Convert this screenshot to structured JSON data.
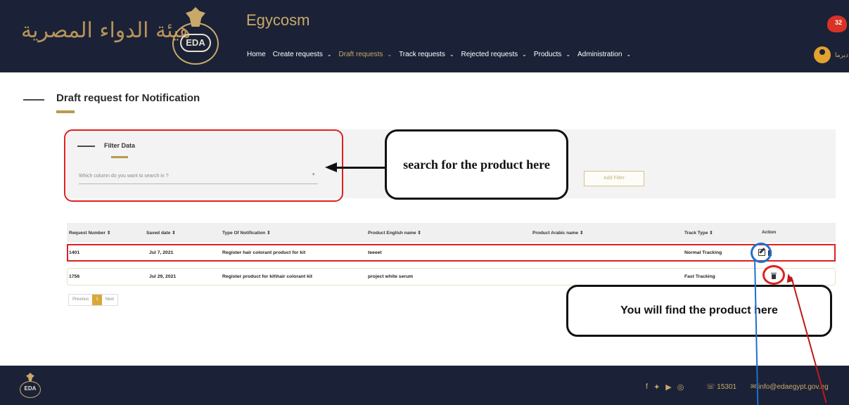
{
  "header": {
    "logo_text": "هيئة الدواء المصرية",
    "emblem_text": "EDA",
    "app_title": "Egycosm",
    "nav": [
      {
        "label": "Home",
        "dropdown": false,
        "active": false
      },
      {
        "label": "Create requests",
        "dropdown": true,
        "active": false
      },
      {
        "label": "Draft requests",
        "dropdown": true,
        "active": true
      },
      {
        "label": "Track requests",
        "dropdown": true,
        "active": false
      },
      {
        "label": "Rejected requests",
        "dropdown": true,
        "active": false
      },
      {
        "label": "Products",
        "dropdown": true,
        "active": false
      },
      {
        "label": "Administration",
        "dropdown": true,
        "active": false
      }
    ],
    "notification_count": "32",
    "user_name": "ديرما"
  },
  "page": {
    "title": "Draft request for Notification"
  },
  "filter": {
    "title": "Filter Data",
    "select_placeholder": "Which column do you want to search in ?",
    "add_filter_label": "Add Filter"
  },
  "table": {
    "columns": [
      "Request Number ⇕",
      "Saved date ⇕",
      "Type Of Notification ⇕",
      "Product English name ⇕",
      "Product Arabic name ⇕",
      "Track Type ⇕",
      "Action"
    ],
    "rows": [
      {
        "request_number": "1401",
        "saved_date": "Jul 7, 2021",
        "type": "Register hair colorant product for kit",
        "english_name": "teeeet",
        "arabic_name": "",
        "track_type": "Normal Tracking"
      },
      {
        "request_number": "1756",
        "saved_date": "Jul 29, 2021",
        "type": "Register product for kit\\hair colorant kit",
        "english_name": "project white serum",
        "arabic_name": "",
        "track_type": "Fast Tracking"
      }
    ]
  },
  "pagination": {
    "previous": "Previous",
    "current": "1",
    "next": "Next"
  },
  "annotations": {
    "search_callout": "search for the product here",
    "find_callout": "You will find the product here"
  },
  "footer": {
    "logo_text": "EDA",
    "phone": "15301",
    "email": "info@edaegypt.gov.eg",
    "social_icons": [
      "facebook-icon",
      "twitter-icon",
      "youtube-icon",
      "instagram-icon"
    ]
  },
  "colors": {
    "navy": "#1b2237",
    "gold": "#c9a968",
    "accent_red": "#e02020",
    "accent_blue": "#1f6fd0"
  }
}
